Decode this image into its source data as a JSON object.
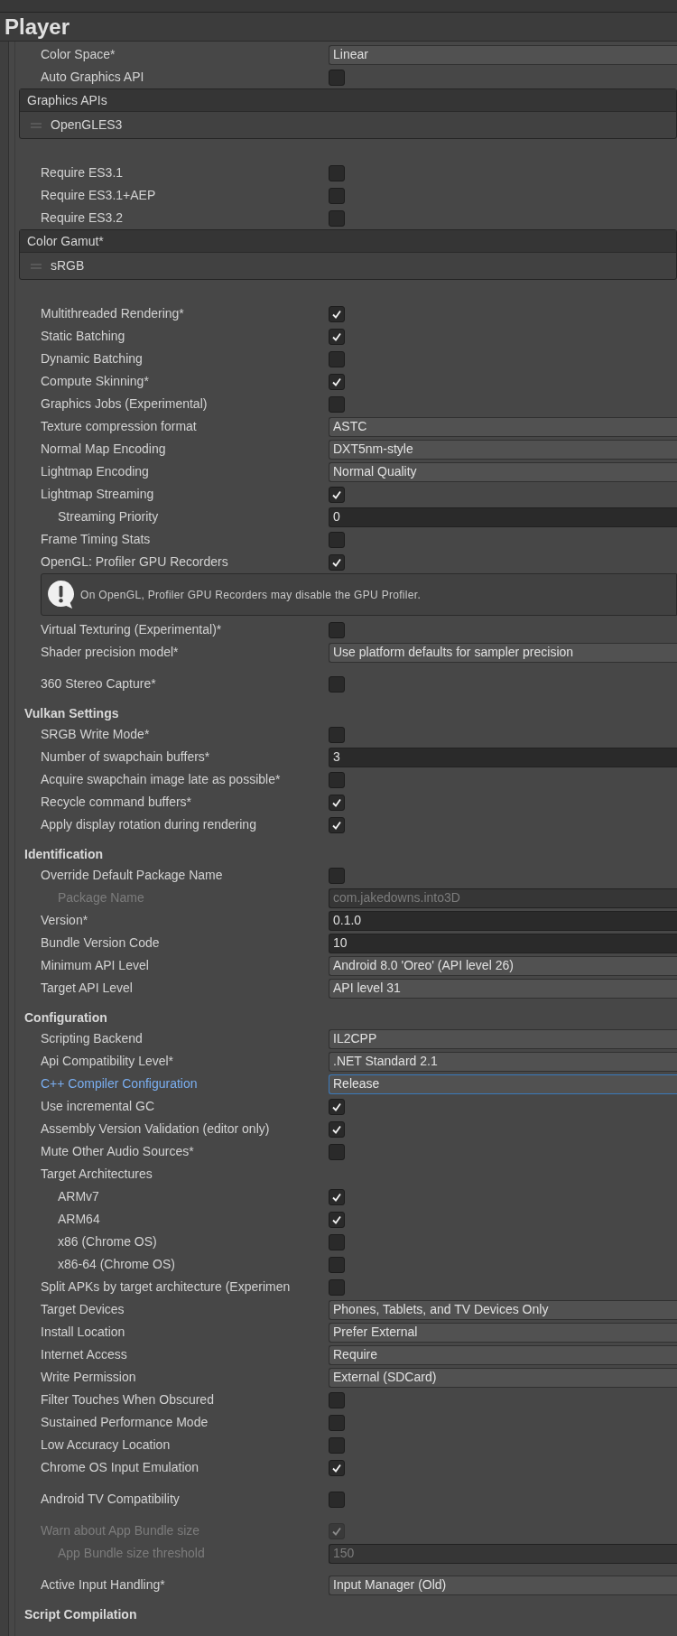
{
  "title": "Player",
  "sections": [
    {
      "groups": [
        [
          {
            "kind": "dropdown",
            "label": "Color Space*",
            "value": "Linear"
          },
          {
            "kind": "checkbox",
            "label": "Auto Graphics API",
            "checked": false
          },
          {
            "kind": "list",
            "header": "Graphics APIs",
            "items": [
              "OpenGLES3"
            ]
          }
        ],
        [
          {
            "kind": "checkbox",
            "label": "Require ES3.1",
            "checked": false
          },
          {
            "kind": "checkbox",
            "label": "Require ES3.1+AEP",
            "checked": false
          },
          {
            "kind": "checkbox",
            "label": "Require ES3.2",
            "checked": false
          },
          {
            "kind": "list",
            "header": "Color Gamut*",
            "items": [
              "sRGB"
            ]
          }
        ],
        [
          {
            "kind": "checkbox",
            "label": "Multithreaded Rendering*",
            "checked": true
          },
          {
            "kind": "checkbox",
            "label": "Static Batching",
            "checked": true
          },
          {
            "kind": "checkbox",
            "label": "Dynamic Batching",
            "checked": false
          },
          {
            "kind": "checkbox",
            "label": "Compute Skinning*",
            "checked": true
          },
          {
            "kind": "checkbox",
            "label": "Graphics Jobs (Experimental)",
            "checked": false
          },
          {
            "kind": "dropdown",
            "label": "Texture compression format",
            "value": "ASTC"
          },
          {
            "kind": "dropdown",
            "label": "Normal Map Encoding",
            "value": "DXT5nm-style"
          },
          {
            "kind": "dropdown",
            "label": "Lightmap Encoding",
            "value": "Normal Quality"
          },
          {
            "kind": "checkbox",
            "label": "Lightmap Streaming",
            "checked": true,
            "children": [
              {
                "kind": "input",
                "label": "Streaming Priority",
                "value": "0"
              }
            ]
          },
          {
            "kind": "checkbox",
            "label": "Frame Timing Stats",
            "checked": false
          },
          {
            "kind": "checkbox",
            "label": "OpenGL: Profiler GPU Recorders",
            "checked": true
          },
          {
            "kind": "warning",
            "text": "On OpenGL, Profiler GPU Recorders may disable the GPU Profiler."
          },
          {
            "kind": "checkbox",
            "label": "Virtual Texturing (Experimental)*",
            "checked": false
          },
          {
            "kind": "dropdown",
            "label": "Shader precision model*",
            "value": "Use platform defaults for sampler precision"
          }
        ],
        [
          {
            "kind": "checkbox",
            "label": "360 Stereo Capture*",
            "checked": false
          }
        ]
      ]
    },
    {
      "heading": "Vulkan Settings",
      "groups": [
        [
          {
            "kind": "checkbox",
            "label": "SRGB Write Mode*",
            "checked": false
          },
          {
            "kind": "input",
            "label": "Number of swapchain buffers*",
            "value": "3"
          },
          {
            "kind": "checkbox",
            "label": "Acquire swapchain image late as possible*",
            "checked": false
          },
          {
            "kind": "checkbox",
            "label": "Recycle command buffers*",
            "checked": true
          },
          {
            "kind": "checkbox",
            "label": "Apply display rotation during rendering",
            "checked": true
          }
        ]
      ]
    },
    {
      "heading": "Identification",
      "groups": [
        [
          {
            "kind": "checkbox",
            "label": "Override Default Package Name",
            "checked": false,
            "children": [
              {
                "kind": "input",
                "label": "Package Name",
                "value": "com.jakedowns.into3D",
                "disabled": true
              }
            ]
          },
          {
            "kind": "input",
            "label": "Version*",
            "value": "0.1.0"
          },
          {
            "kind": "input",
            "label": "Bundle Version Code",
            "value": "10"
          },
          {
            "kind": "dropdown",
            "label": "Minimum API Level",
            "value": "Android 8.0 'Oreo' (API level 26)"
          },
          {
            "kind": "dropdown",
            "label": "Target API Level",
            "value": "API level 31"
          }
        ]
      ]
    },
    {
      "heading": "Configuration",
      "groups": [
        [
          {
            "kind": "dropdown",
            "label": "Scripting Backend",
            "value": "IL2CPP"
          },
          {
            "kind": "dropdown",
            "label": "Api Compatibility Level*",
            "value": ".NET Standard 2.1"
          },
          {
            "kind": "dropdown",
            "label": "C++ Compiler Configuration",
            "value": "Release",
            "focused": true
          },
          {
            "kind": "checkbox",
            "label": "Use incremental GC",
            "checked": true
          },
          {
            "kind": "checkbox",
            "label": "Assembly Version Validation (editor only)",
            "checked": true
          },
          {
            "kind": "checkbox",
            "label": "Mute Other Audio Sources*",
            "checked": false
          },
          {
            "kind": "label",
            "label": "Target Architectures",
            "children": [
              {
                "kind": "checkbox",
                "label": "ARMv7",
                "checked": true
              },
              {
                "kind": "checkbox",
                "label": "ARM64",
                "checked": true
              },
              {
                "kind": "checkbox",
                "label": "x86 (Chrome OS)",
                "checked": false
              },
              {
                "kind": "checkbox",
                "label": "x86-64 (Chrome OS)",
                "checked": false
              }
            ]
          },
          {
            "kind": "checkbox",
            "label": "Split APKs by target architecture (Experimen",
            "checked": false
          },
          {
            "kind": "dropdown",
            "label": "Target Devices",
            "value": "Phones, Tablets, and TV Devices Only"
          },
          {
            "kind": "dropdown",
            "label": "Install Location",
            "value": "Prefer External"
          },
          {
            "kind": "dropdown",
            "label": "Internet Access",
            "value": "Require"
          },
          {
            "kind": "dropdown",
            "label": "Write Permission",
            "value": "External (SDCard)"
          },
          {
            "kind": "checkbox",
            "label": "Filter Touches When Obscured",
            "checked": false
          },
          {
            "kind": "checkbox",
            "label": "Sustained Performance Mode",
            "checked": false
          },
          {
            "kind": "checkbox",
            "label": "Low Accuracy Location",
            "checked": false
          },
          {
            "kind": "checkbox",
            "label": "Chrome OS Input Emulation",
            "checked": true
          }
        ],
        [
          {
            "kind": "checkbox",
            "label": "Android TV Compatibility",
            "checked": false
          }
        ],
        [
          {
            "kind": "checkbox",
            "label": "Warn about App Bundle size",
            "checked": true,
            "disabled": true,
            "children": [
              {
                "kind": "input",
                "label": "App Bundle size threshold",
                "value": "150",
                "disabled": true
              }
            ]
          }
        ],
        [
          {
            "kind": "dropdown",
            "label": "Active Input Handling*",
            "value": "Input Manager (Old)"
          }
        ]
      ]
    },
    {
      "heading": "Script Compilation"
    }
  ]
}
